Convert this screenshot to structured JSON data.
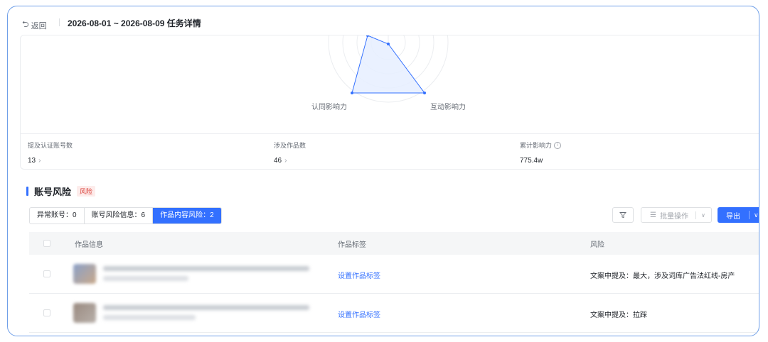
{
  "header": {
    "back_label": "返回",
    "title": "2026-08-01 ~ 2026-08-09 任务详情"
  },
  "radar": {
    "labels": {
      "left": "认同影响力",
      "right": "互动影响力"
    },
    "fill_color": "#e6eeff",
    "stroke_color": "#3370ff"
  },
  "stats": [
    {
      "label": "提及认证账号数",
      "value": "13",
      "has_link": true
    },
    {
      "label": "涉及作品数",
      "value": "46",
      "has_link": true
    },
    {
      "label": "累计影响力",
      "value": "775.4w",
      "has_info": true
    }
  ],
  "section": {
    "title": "账号风险",
    "badge": "风险"
  },
  "tabs": [
    {
      "label": "异常账号：0",
      "active": false
    },
    {
      "label": "账号风险信息：6",
      "active": false
    },
    {
      "label": "作品内容风险：2",
      "active": true
    }
  ],
  "toolbar": {
    "batch_label": "批量操作",
    "export_label": "导出"
  },
  "table": {
    "columns": [
      "作品信息",
      "作品标签",
      "风险"
    ],
    "rows": [
      {
        "tag_link": "设置作品标签",
        "risk": "文案中提及：最大，涉及词库广告法红线-房产"
      },
      {
        "tag_link": "设置作品标签",
        "risk": "文案中提及：拉踩"
      }
    ]
  },
  "colors": {
    "accent": "#3370ff",
    "frame_border": "#6f9fe8",
    "danger": "#d83931"
  }
}
